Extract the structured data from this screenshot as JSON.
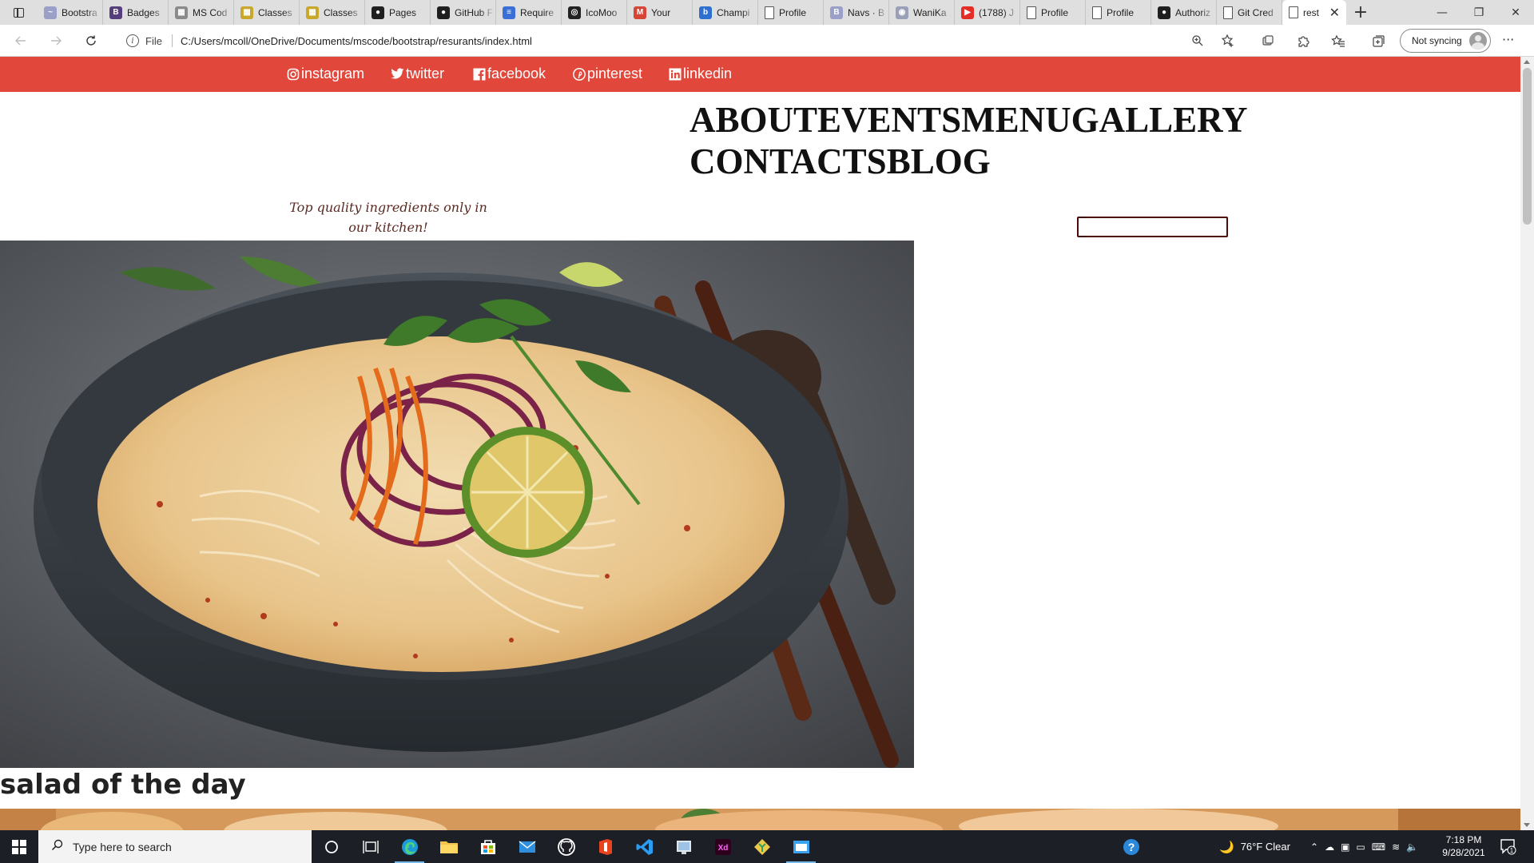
{
  "browser": {
    "tabs": [
      {
        "label": "Bootstra",
        "fav_color": "#9aa0c8",
        "fav_text": "~"
      },
      {
        "label": "Badges",
        "fav_color": "#563d7c",
        "fav_text": "B"
      },
      {
        "label": "MS Cod",
        "fav_color": "#8a8a8a",
        "fav_text": "▦"
      },
      {
        "label": "Classes",
        "fav_color": "#c8a82a",
        "fav_text": "▦"
      },
      {
        "label": "Classes",
        "fav_color": "#c8a82a",
        "fav_text": "▦"
      },
      {
        "label": "Pages",
        "fav_color": "#1f1f1f",
        "fav_text": "●"
      },
      {
        "label": "GitHub F",
        "fav_color": "#1f1f1f",
        "fav_text": "●"
      },
      {
        "label": "Require",
        "fav_color": "#3a6fd8",
        "fav_text": "≡"
      },
      {
        "label": "IcoMoo",
        "fav_color": "#222222",
        "fav_text": "◎"
      },
      {
        "label": "Your",
        "fav_color": "#d64535",
        "fav_text": "M"
      },
      {
        "label": "Champi",
        "fav_color": "#2f6fd0",
        "fav_text": "b"
      },
      {
        "label": "Profile",
        "fav_color": "#ffffff",
        "fav_text": "▯"
      },
      {
        "label": "Navs · B",
        "fav_color": "#9aa0c8",
        "fav_text": "B"
      },
      {
        "label": "WaniKa",
        "fav_color": "#9aa0b8",
        "fav_text": "◉"
      },
      {
        "label": "(1788) J",
        "fav_color": "#e52d27",
        "fav_text": "▶"
      },
      {
        "label": "Profile",
        "fav_color": "#ffffff",
        "fav_text": "▯"
      },
      {
        "label": "Profile",
        "fav_color": "#ffffff",
        "fav_text": "▯"
      },
      {
        "label": "Authoriz",
        "fav_color": "#1f1f1f",
        "fav_text": "●"
      },
      {
        "label": "Git Cred",
        "fav_color": "#ffffff",
        "fav_text": "▯"
      }
    ],
    "active_tab": {
      "label": "rest",
      "close": "✕"
    },
    "new_tab": "+",
    "window_controls": {
      "minimize": "—",
      "restore": "❐",
      "close": "✕"
    },
    "address": {
      "scheme_label": "File",
      "url": "C:/Users/mcoll/OneDrive/Documents/mscode/bootstrap/resurants/index.html"
    },
    "sync_label": "Not syncing",
    "more": "···"
  },
  "page": {
    "social_links": [
      {
        "name": "instagram",
        "label": "instagram",
        "icon": "instagram-icon"
      },
      {
        "name": "twitter",
        "label": "twitter",
        "icon": "twitter-icon"
      },
      {
        "name": "facebook",
        "label": "facebook",
        "icon": "facebook-icon"
      },
      {
        "name": "pinterest",
        "label": "pinterest",
        "icon": "pinterest-icon"
      },
      {
        "name": "linkedin",
        "label": "linkedin",
        "icon": "linkedin-icon"
      }
    ],
    "nav": [
      "ABOUT",
      "EVENTS",
      "MENU",
      "GALLERY",
      "CONTACTS",
      "BLOG"
    ],
    "tagline": "Top quality ingredients only in our kitchen!",
    "search_value": "",
    "dish_title": "salad of the day",
    "colors": {
      "social_bar": "#e2473c",
      "search_border": "#4a0c0c"
    }
  },
  "taskbar": {
    "search_placeholder": "Type here to search",
    "weather": "76°F  Clear",
    "time": "7:18 PM",
    "date": "9/28/2021",
    "notification_count": "1",
    "apps": [
      "cortana",
      "task-view",
      "edge",
      "file-explorer",
      "store",
      "mail",
      "github-desktop",
      "office",
      "vscode",
      "paint",
      "adobe-xd",
      "git",
      "blue-app"
    ]
  }
}
